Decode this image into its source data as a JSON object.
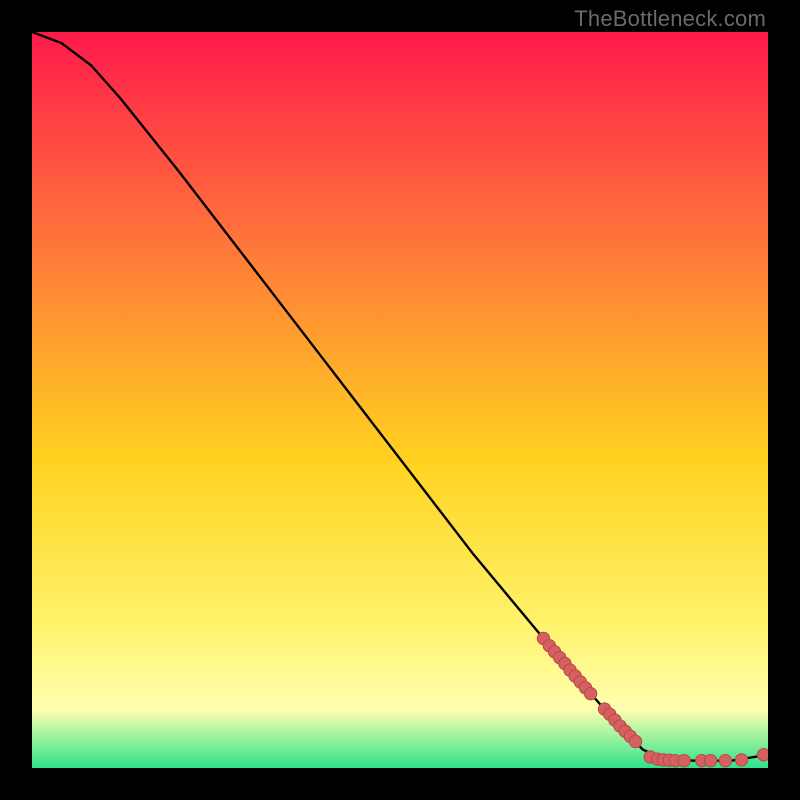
{
  "watermark": "TheBottleneck.com",
  "colors": {
    "gradient_top": "#ff1a4b",
    "gradient_mid1": "#ff7a3a",
    "gradient_mid2": "#ffd21f",
    "gradient_mid3": "#fff26a",
    "gradient_mid4": "#ffffb0",
    "gradient_bottom": "#2fe38a",
    "curve": "#000000",
    "marker_fill": "#d66060",
    "marker_stroke": "#b54a4a"
  },
  "chart_data": {
    "type": "line",
    "title": "",
    "xlabel": "",
    "ylabel": "",
    "xlim": [
      0,
      100
    ],
    "ylim": [
      0,
      100
    ],
    "note": "Axes not shown; values estimated from pixel positions. Curve is bottleneck vs some x parameter, falling to near-zero then flat.",
    "curve": [
      {
        "x": 0,
        "y": 100
      },
      {
        "x": 4,
        "y": 98.5
      },
      {
        "x": 8,
        "y": 95.5
      },
      {
        "x": 12,
        "y": 91
      },
      {
        "x": 20,
        "y": 81
      },
      {
        "x": 30,
        "y": 68
      },
      {
        "x": 40,
        "y": 55
      },
      {
        "x": 50,
        "y": 42
      },
      {
        "x": 60,
        "y": 29
      },
      {
        "x": 70,
        "y": 17
      },
      {
        "x": 76,
        "y": 10
      },
      {
        "x": 80,
        "y": 5.5
      },
      {
        "x": 83,
        "y": 2.5
      },
      {
        "x": 86,
        "y": 1.2
      },
      {
        "x": 90,
        "y": 1.0
      },
      {
        "x": 95,
        "y": 1.0
      },
      {
        "x": 100,
        "y": 1.8
      }
    ],
    "markers": [
      {
        "x": 69.5,
        "y": 17.6
      },
      {
        "x": 70.3,
        "y": 16.6
      },
      {
        "x": 71.0,
        "y": 15.8
      },
      {
        "x": 71.7,
        "y": 15.0
      },
      {
        "x": 72.4,
        "y": 14.2
      },
      {
        "x": 73.1,
        "y": 13.3
      },
      {
        "x": 73.8,
        "y": 12.5
      },
      {
        "x": 74.5,
        "y": 11.7
      },
      {
        "x": 75.2,
        "y": 10.9
      },
      {
        "x": 75.9,
        "y": 10.1
      },
      {
        "x": 77.8,
        "y": 8.0
      },
      {
        "x": 78.5,
        "y": 7.3
      },
      {
        "x": 79.2,
        "y": 6.5
      },
      {
        "x": 79.9,
        "y": 5.7
      },
      {
        "x": 80.6,
        "y": 5.0
      },
      {
        "x": 81.3,
        "y": 4.3
      },
      {
        "x": 82.0,
        "y": 3.6
      },
      {
        "x": 84.0,
        "y": 1.5
      },
      {
        "x": 85.0,
        "y": 1.2
      },
      {
        "x": 85.8,
        "y": 1.1
      },
      {
        "x": 86.6,
        "y": 1.05
      },
      {
        "x": 87.4,
        "y": 1.0
      },
      {
        "x": 88.6,
        "y": 1.0
      },
      {
        "x": 91.0,
        "y": 1.0
      },
      {
        "x": 92.2,
        "y": 1.0
      },
      {
        "x": 94.2,
        "y": 1.0
      },
      {
        "x": 96.4,
        "y": 1.1
      },
      {
        "x": 99.4,
        "y": 1.8
      }
    ]
  }
}
